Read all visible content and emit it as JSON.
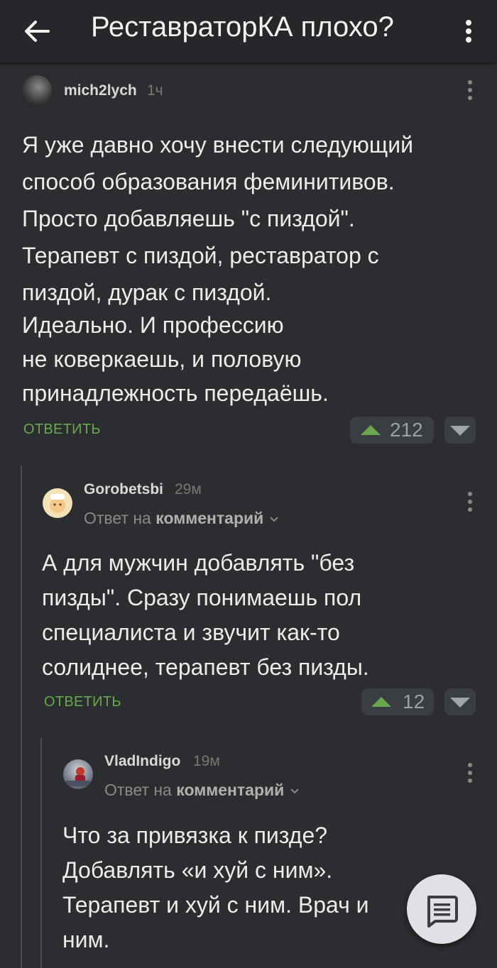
{
  "header": {
    "title": "РеставраторКА плохо?"
  },
  "comments": [
    {
      "author": "mich2lych",
      "time": "1ч",
      "lines": [
        "Я уже давно хочу внести следующий",
        "способ образования феминитивов.",
        "Просто добавляешь \"с пиздой\".",
        "Терапевт с пиздой, реставратор с",
        "пиздой, дурак с пиздой.",
        "Идеально. И профессию",
        "не коверкаешь, и половую",
        "принадлежность передаёшь."
      ],
      "reply_label": "ОТВЕТИТЬ",
      "rating": "212"
    },
    {
      "author": "Gorobetsbi",
      "time": "29м",
      "reply_to_prefix": "Ответ на",
      "reply_to_target": "комментарий",
      "lines": [
        "А для мужчин добавлять \"без",
        "пизды\". Сразу понимаешь пол",
        "специалиста и звучит как-то",
        "солиднее, терапевт без пизды."
      ],
      "reply_label": "ОТВЕТИТЬ",
      "rating": "12"
    },
    {
      "author": "VladIndigo",
      "time": "19м",
      "reply_to_prefix": "Ответ на",
      "reply_to_target": "комментарий",
      "lines": [
        "Что за привязка к пизде?",
        "Добавлять «и хуй с ним».",
        "Терапевт и хуй с ним. Врач и",
        "ним."
      ]
    }
  ],
  "colors": {
    "accent": "#6aa84f",
    "background": "#2b2d30",
    "header": "#25272a"
  }
}
